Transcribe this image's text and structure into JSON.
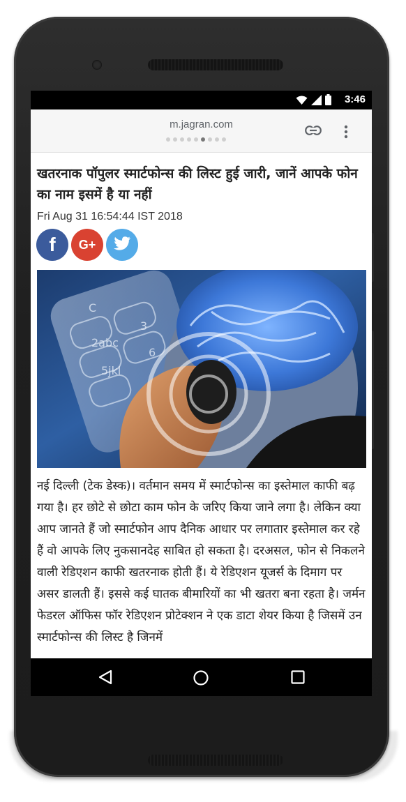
{
  "status_bar": {
    "time": "3:46",
    "icons": [
      "wifi-icon",
      "cellular-signal-icon",
      "battery-icon"
    ]
  },
  "browser": {
    "url": "m.jagran.com",
    "page_dots": {
      "count": 9,
      "active_index": 5
    },
    "icons": [
      "link-icon",
      "overflow-menu-icon"
    ]
  },
  "article": {
    "headline": "खतरनाक पॉपुलर स्मार्टफोन्स की लिस्ट हुई जारी, जानें आपके फोन का नाम इसमें है या नहीं",
    "date": "Fri Aug 31 16:54:44 IST 2018",
    "share": {
      "facebook": "f",
      "google_plus": "G+",
      "twitter_icon": "twitter-bird-icon"
    },
    "body": "नई दिल्ली (टेक डेस्क)। वर्तमान समय में स्मार्टफोन्स का इस्तेमाल काफी बढ़ गया है। हर छोटे से छोटा काम फोन के जरिए किया जाने लगा है। लेकिन क्या आप जानते हैं जो स्मार्टफोन आप दैनिक आधार पर लगातार इस्तेमाल कर रहे हैं वो आपके लिए नुकसानदेह साबित हो सकता है। दरअसल, फोन से निकलने वाली रेडिएशन काफी खतरनाक होती हैं। ये रेडिएशन यूजर्स के दिमाग पर असर डालती हैं। इससे कई घातक बीमारियों का भी खतरा बना रहता है। जर्मन फेडरल ऑफिस फॉर रेडिएशन प्रोटेक्शन ने एक डाटा शेयर किया है जिसमें उन स्मार्टफोन्स की लिस्ट है जिनमें"
  },
  "hero_image": {
    "keypad_labels": [
      "C",
      "2abc",
      "3",
      "5jkl",
      "6"
    ]
  },
  "colors": {
    "facebook": "#3b5b9c",
    "google_plus": "#d94231",
    "twitter": "#54abe8",
    "phone_body": "#1f1f1f"
  },
  "nav_bar": {
    "buttons": [
      "back-icon",
      "home-icon",
      "recents-icon"
    ]
  }
}
